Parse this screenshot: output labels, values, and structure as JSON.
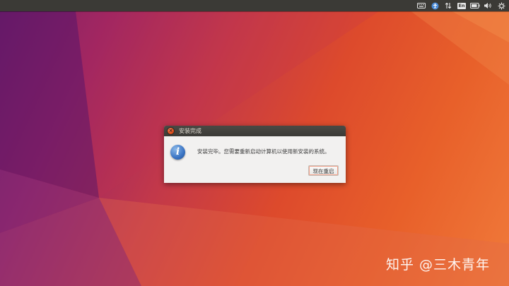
{
  "topbar": {
    "keyboard_icon": "keyboard-icon",
    "accessibility_icon": "accessibility-icon",
    "network_icon": "network-arrows-icon",
    "input_method_label": "En",
    "battery_icon": "battery-icon",
    "volume_icon": "volume-icon",
    "power_icon": "gear-power-icon"
  },
  "dialog": {
    "title": "安装完成",
    "message": "安装完毕。您需要重新启动计算机以使用新安装的系统。",
    "button_label": "现在重启",
    "close_glyph": "×"
  },
  "watermark": {
    "text": "知乎 @三木青年"
  },
  "colors": {
    "topbar": "#3b3a36",
    "close": "#df4b16",
    "info": "#3a74c4"
  }
}
